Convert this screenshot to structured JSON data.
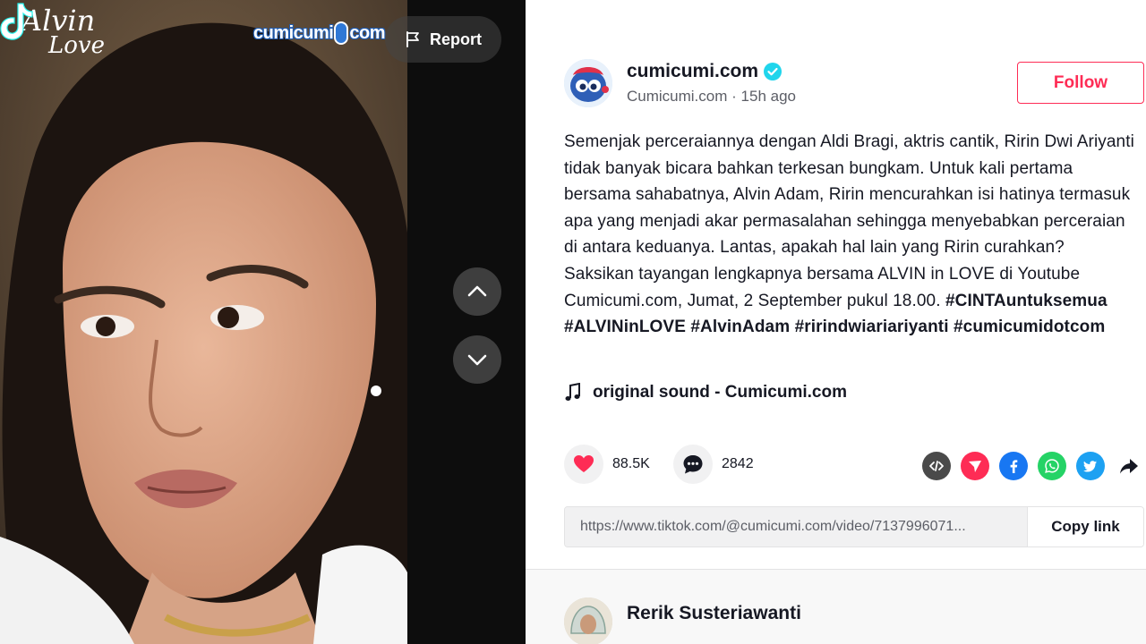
{
  "video": {
    "show_logo_line1": "Alvin",
    "show_logo_line2": "Love",
    "brand_logo_text_a": "cumicumi",
    "brand_logo_text_b": "com",
    "report_label": "Report"
  },
  "author": {
    "username": "cumicumi.com",
    "display_name": "Cumicumi.com",
    "separator": "·",
    "posted_ago": "15h ago",
    "follow_label": "Follow"
  },
  "caption": {
    "text": "Semenjak perceraiannya dengan Aldi Bragi, aktris cantik, Ririn Dwi Ariyanti tidak banyak bicara bahkan terkesan bungkam. Untuk kali pertama bersama sahabatnya, Alvin Adam, Ririn mencurahkan isi hatinya termasuk apa yang menjadi akar permasalahan sehingga menyebabkan perceraian di antara keduanya. Lantas, apakah hal lain yang Ririn curahkan? Saksikan tayangan lengkapnya bersama ALVIN in LOVE di Youtube Cumicumi.com, Jumat, 2 September pukul 18.00. ",
    "hashtags": [
      "#CINTAuntuksemua",
      "#ALVINinLOVE",
      "#AlvinAdam",
      "#ririndwiariariyanti",
      "#cumicumidotcom"
    ]
  },
  "music": {
    "label": "original sound - Cumicumi.com"
  },
  "stats": {
    "likes": "88.5K",
    "comments": "2842"
  },
  "share": {
    "icons": [
      "embed-icon",
      "send-icon",
      "facebook-icon",
      "whatsapp-icon",
      "twitter-icon",
      "share-arrow-icon"
    ],
    "colors": {
      "embed": "#4a4a4a",
      "send": "#fe2c55",
      "facebook": "#1877f2",
      "whatsapp": "#25d366",
      "twitter": "#1da1f2"
    }
  },
  "link": {
    "url": "https://www.tiktok.com/@cumicumi.com/video/7137996071...",
    "copy_label": "Copy link"
  },
  "comments": [
    {
      "author": "Rerik Susteriawanti"
    }
  ],
  "colors": {
    "accent": "#fe2c55",
    "verified": "#20d5ec",
    "text": "#161823",
    "muted": "#5c5e66"
  }
}
